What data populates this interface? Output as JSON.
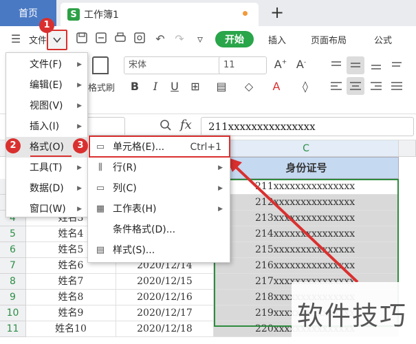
{
  "tabs": {
    "home": "首页",
    "doc_title": "工作簿1",
    "doc_icon": "S"
  },
  "toolbar": {
    "file_label": "文件",
    "start": "开始",
    "menu_tabs": [
      "插入",
      "页面布局",
      "公式"
    ]
  },
  "ribbon": {
    "font_name": "宋体",
    "font_size": "11",
    "format_painter": "格式刷"
  },
  "formula_bar": {
    "fx": "fx",
    "value": "211xxxxxxxxxxxxxxx"
  },
  "file_menu": {
    "items": [
      "文件(F)",
      "编辑(E)",
      "视图(V)",
      "插入(I)",
      "格式(O)",
      "工具(T)",
      "数据(D)",
      "窗口(W)"
    ]
  },
  "format_submenu": {
    "items": [
      {
        "label": "单元格(E)...",
        "shortcut": "Ctrl+1",
        "icon": "cell-format-icon"
      },
      {
        "label": "行(R)",
        "shortcut": "",
        "icon": "row-icon"
      },
      {
        "label": "列(C)",
        "shortcut": "",
        "icon": "column-icon"
      },
      {
        "label": "工作表(H)",
        "shortcut": "",
        "icon": "sheet-icon"
      },
      {
        "label": "条件格式(D)...",
        "shortcut": "",
        "icon": ""
      },
      {
        "label": "样式(S)...",
        "shortcut": "",
        "icon": "style-icon"
      }
    ]
  },
  "badges": [
    "1",
    "2",
    "3"
  ],
  "sheet": {
    "col_c_letter": "C",
    "col_c_header": "身份证号",
    "row_numbers": [
      "4",
      "5",
      "6",
      "7",
      "8",
      "9",
      "10",
      "11"
    ],
    "ids": [
      "211xxxxxxxxxxxxxxx",
      "212xxxxxxxxxxxxxxx",
      "213xxxxxxxxxxxxxxx",
      "214xxxxxxxxxxxxxxx",
      "215xxxxxxxxxxxxxxx",
      "216xxxxxxxxxxxxxxx",
      "217xxxxxxxxxxxxxxx",
      "218xxxxxxxxxxxxxxx",
      "219xxxxxxxxxxxxxxx",
      "220xxxxxxxxxxxxxxx"
    ],
    "visible_rows": [
      {
        "name": "姓名3",
        "date": ""
      },
      {
        "name": "姓名4",
        "date": ""
      },
      {
        "name": "姓名5",
        "date": ""
      },
      {
        "name": "姓名6",
        "date": "2020/12/14"
      },
      {
        "name": "姓名7",
        "date": "2020/12/15"
      },
      {
        "name": "姓名8",
        "date": "2020/12/16"
      },
      {
        "name": "姓名9",
        "date": "2020/12/17"
      },
      {
        "name": "姓名10",
        "date": "2020/12/18"
      }
    ]
  },
  "watermark": "软件技巧",
  "colors": {
    "accent_green": "#29a54a",
    "highlight_red": "#d9302f",
    "header_blue": "#c5d9f1",
    "home_tab_blue": "#4a79c4"
  }
}
